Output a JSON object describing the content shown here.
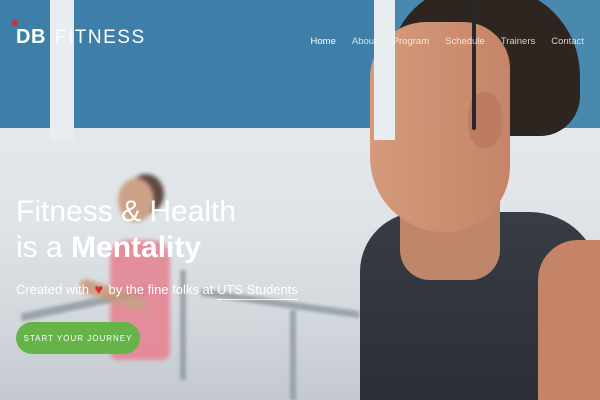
{
  "nav": {
    "logo_bold": "DB",
    "logo_text": "FITNESS",
    "items": [
      {
        "label": "Home",
        "active": true
      },
      {
        "label": "About",
        "active": false
      },
      {
        "label": "Program",
        "active": false
      },
      {
        "label": "Schedule",
        "active": false
      },
      {
        "label": "Trainers",
        "active": false
      },
      {
        "label": "Contact",
        "active": false
      }
    ]
  },
  "hero": {
    "headline_line1": "Fitness & Health",
    "headline_line2_prefix": "is a",
    "headline_line2_bold": "Mentality",
    "tagline_prefix": "Created with",
    "tagline_middle": "by the fine folks at",
    "tagline_link": "UTS Students",
    "cta_label": "START YOUR JOURNEY"
  },
  "colors": {
    "accent_green": "#65b349",
    "heart_red": "#e0262d",
    "logo_dot_red": "#e0262d"
  },
  "icons": {
    "heart": "heart-icon",
    "logo_dot": "logo-dot-icon"
  }
}
